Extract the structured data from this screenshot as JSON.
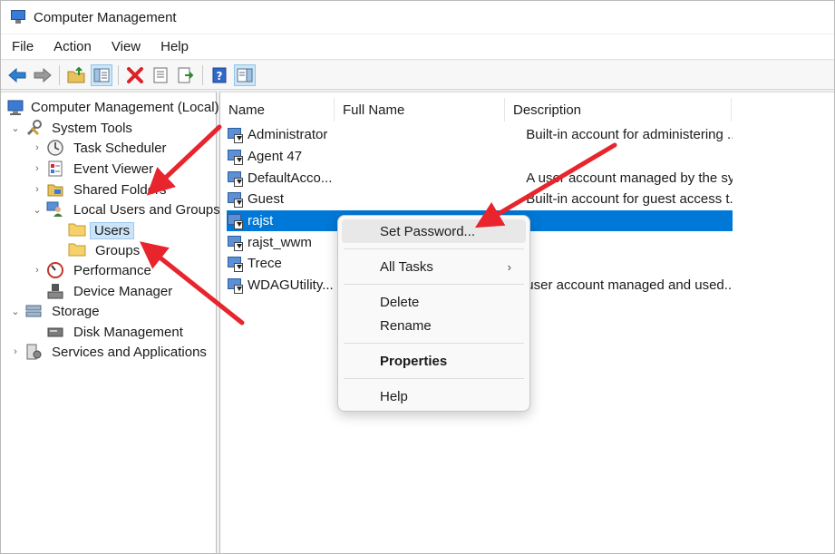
{
  "window": {
    "title": "Computer Management"
  },
  "menu": [
    "File",
    "Action",
    "View",
    "Help"
  ],
  "toolbar": {
    "icons": [
      "back-arrow-icon",
      "forward-arrow-icon",
      "up-folder-icon",
      "show-hide-tree-icon",
      "delete-icon",
      "properties-icon",
      "export-list-icon",
      "help-icon",
      "show-action-pane-icon"
    ]
  },
  "tree": {
    "root": "Computer Management (Local)",
    "system_tools": "System Tools",
    "task_scheduler": "Task Scheduler",
    "event_viewer": "Event Viewer",
    "shared_folders": "Shared Folders",
    "local_users_groups": "Local Users and Groups",
    "users": "Users",
    "groups": "Groups",
    "performance": "Performance",
    "device_manager": "Device Manager",
    "storage": "Storage",
    "disk_management": "Disk Management",
    "services_apps": "Services and Applications"
  },
  "columns": {
    "name": "Name",
    "full_name": "Full Name",
    "description": "Description"
  },
  "users": [
    {
      "name": "Administrator",
      "full_name": "",
      "description": "Built-in account for administering ..."
    },
    {
      "name": "Agent 47",
      "full_name": "",
      "description": ""
    },
    {
      "name": "DefaultAcco...",
      "full_name": "",
      "description": "A user account managed by the sy..."
    },
    {
      "name": "Guest",
      "full_name": "",
      "description": "Built-in account for guest access t..."
    },
    {
      "name": "rajst",
      "full_name": "",
      "description": ""
    },
    {
      "name": "rajst_wwm",
      "full_name": "",
      "description": ""
    },
    {
      "name": "Trece",
      "full_name": "",
      "description": ""
    },
    {
      "name": "WDAGUtility...",
      "full_name": "",
      "description": "user account managed and used..."
    }
  ],
  "context_menu": {
    "set_password": "Set Password...",
    "all_tasks": "All Tasks",
    "delete": "Delete",
    "rename": "Rename",
    "properties": "Properties",
    "help": "Help"
  },
  "colors": {
    "selection": "#0078d7",
    "annotation_arrow": "#e8242c"
  }
}
